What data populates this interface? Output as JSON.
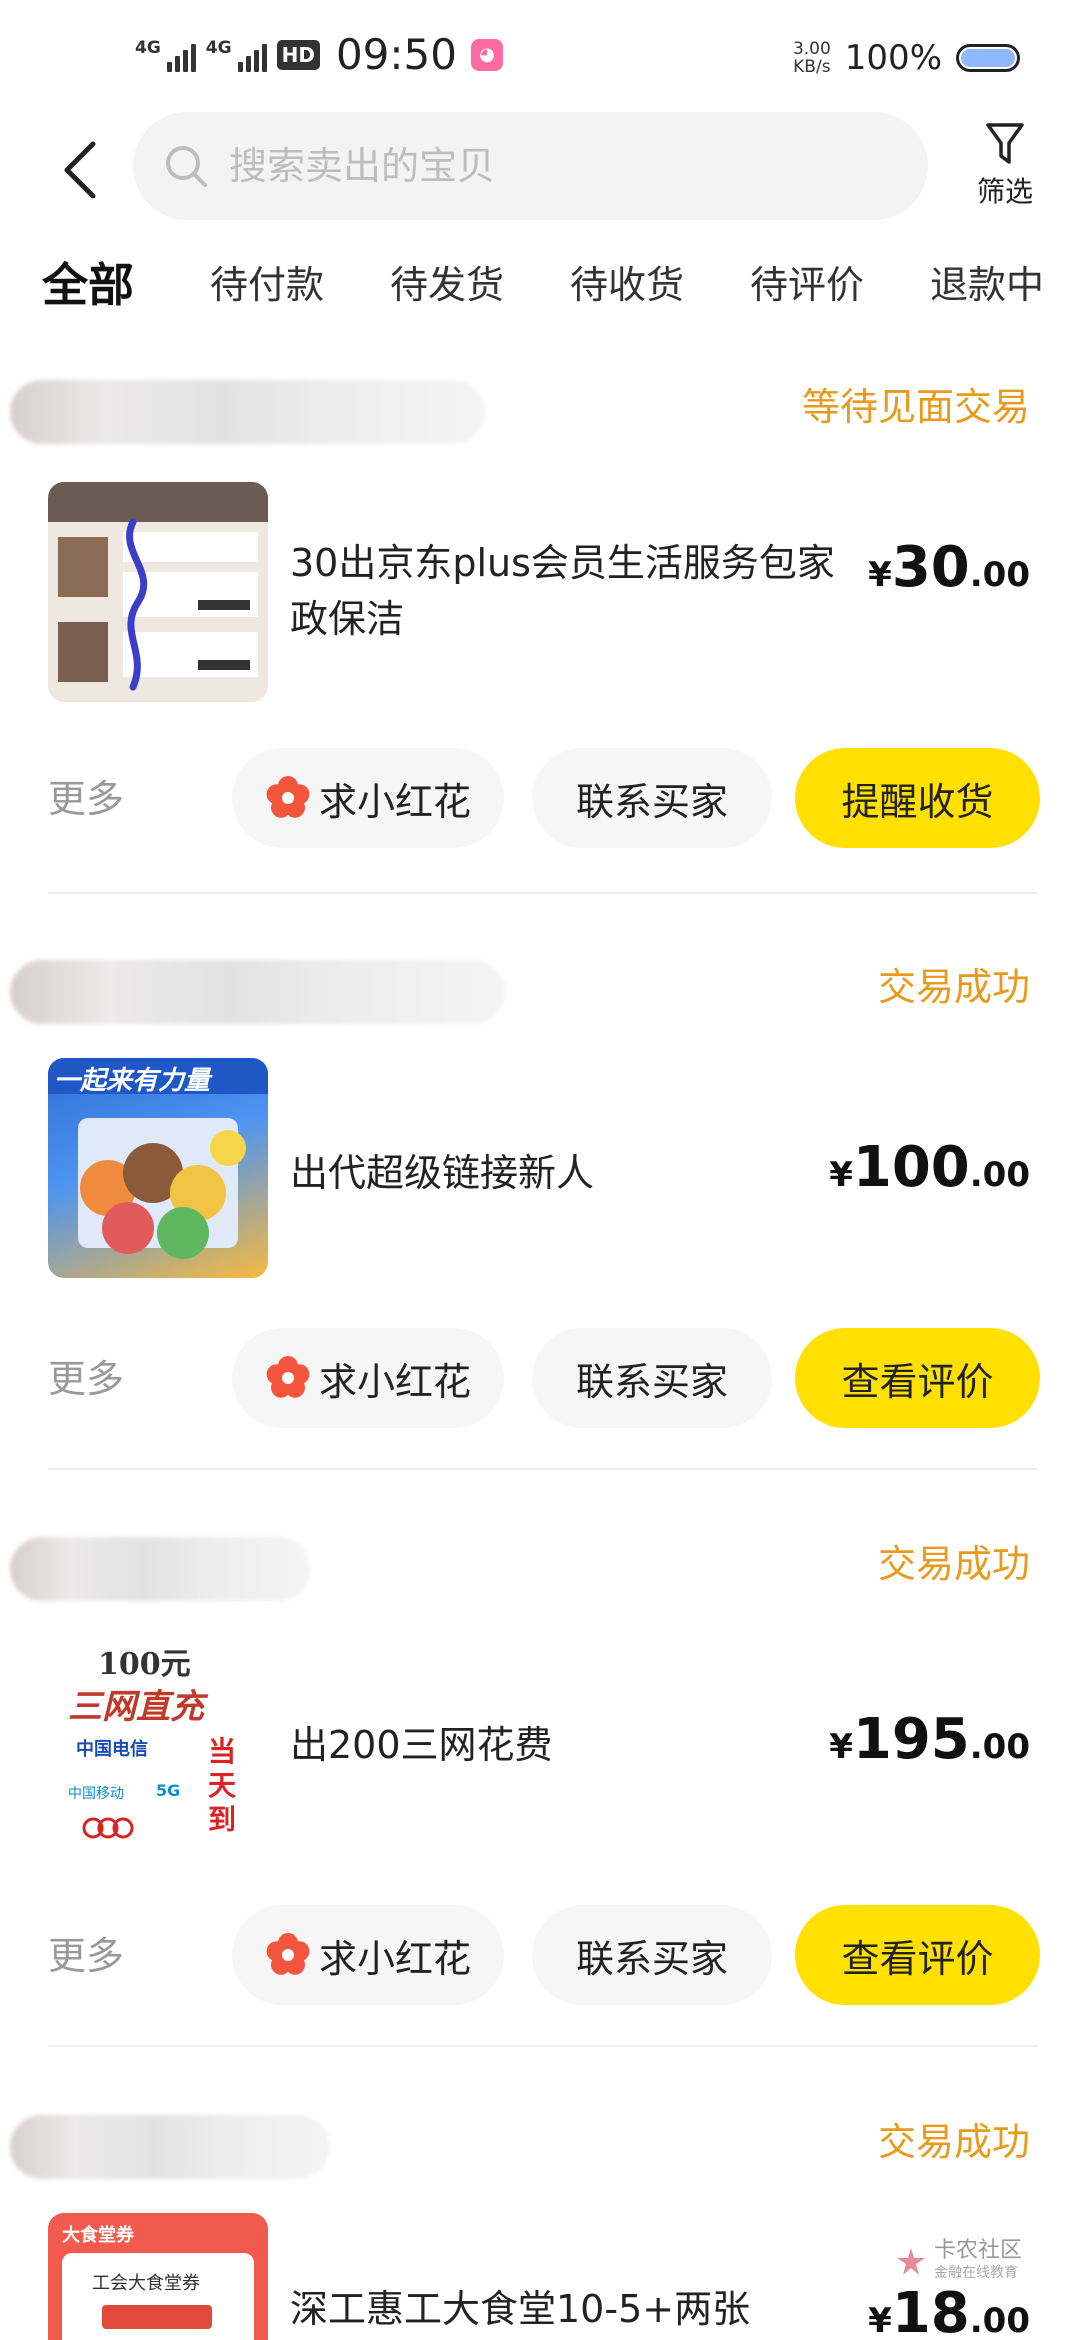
{
  "status_bar": {
    "signal1": "4G",
    "signal2": "4G",
    "hd": "HD",
    "time": "09:50",
    "net_speed_value": "3.00",
    "net_speed_unit": "KB/s",
    "battery": "100%"
  },
  "header": {
    "search_placeholder": "搜索卖出的宝贝",
    "filter_label": "筛选"
  },
  "tabs": [
    {
      "label": "全部",
      "active": true
    },
    {
      "label": "待付款"
    },
    {
      "label": "待发货"
    },
    {
      "label": "待收货"
    },
    {
      "label": "待评价"
    },
    {
      "label": "退款中"
    }
  ],
  "orders": [
    {
      "status": "等待见面交易",
      "title": "30出京东plus会员生活服务包家政保洁",
      "price_currency": "¥",
      "price_int": "30",
      "price_dec": ".00",
      "more": "更多",
      "flower_btn": "求小红花",
      "contact_btn": "联系买家",
      "primary_btn": "提醒收货"
    },
    {
      "status": "交易成功",
      "title": "出代超级链接新人",
      "price_currency": "¥",
      "price_int": "100",
      "price_dec": ".00",
      "more": "更多",
      "flower_btn": "求小红花",
      "contact_btn": "联系买家",
      "primary_btn": "查看评价"
    },
    {
      "status": "交易成功",
      "title": "出200三网花费",
      "price_currency": "¥",
      "price_int": "195",
      "price_dec": ".00",
      "more": "更多",
      "flower_btn": "求小红花",
      "contact_btn": "联系买家",
      "primary_btn": "查看评价"
    },
    {
      "status": "交易成功",
      "title": "深工惠工大食堂10-5+两张",
      "price_currency": "¥",
      "price_int": "18",
      "price_dec": ".00"
    }
  ],
  "thumb_texts": {
    "t2_banner": "一起来有力量",
    "t3_line1": "100元",
    "t3_line2": "三网直充",
    "t3_side": "当天到",
    "t3_telecom": "中国电信",
    "t3_mobile": "中国移动",
    "t3_5g": "5G",
    "t4_top": "大食堂券",
    "t4_mid": "工会大食堂券"
  },
  "watermark": {
    "name": "卡农社区",
    "sub": "金融在线教育"
  },
  "colors": {
    "accent_yellow": "#ffe000",
    "status_orange": "#e89a1d",
    "flower_red": "#f2553c"
  }
}
